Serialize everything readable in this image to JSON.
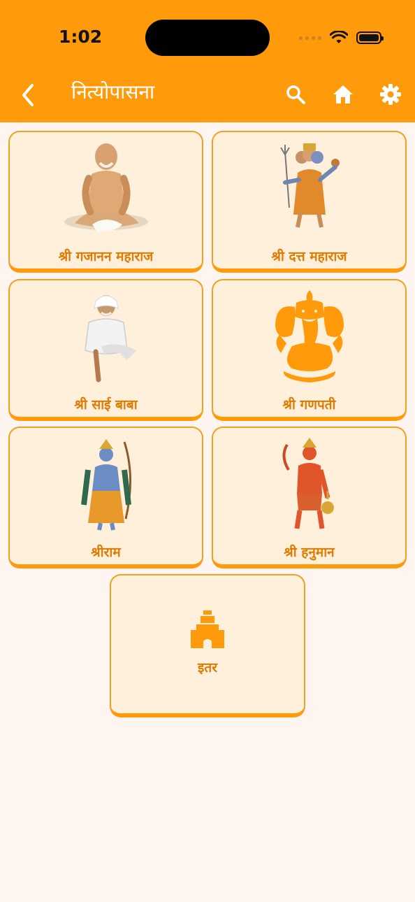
{
  "status_bar": {
    "time": "1:02"
  },
  "header": {
    "title": "नित्योपासना",
    "back_icon": "chevron-left-icon",
    "actions": [
      "search-icon",
      "home-icon",
      "gear-icon"
    ]
  },
  "colors": {
    "accent": "#FF9A0B",
    "card_bg": "#FFF0DB",
    "label": "#E07A00",
    "page_bg": "#FEF5F0"
  },
  "cards": [
    {
      "label": "श्री गजानन महाराज",
      "image": "gajanan-maharaj-image"
    },
    {
      "label": "श्री दत्त महाराज",
      "image": "datta-maharaj-image"
    },
    {
      "label": "श्री साई बाबा",
      "image": "sai-baba-image"
    },
    {
      "label": "श्री गणपती",
      "image": "ganpati-image"
    },
    {
      "label": "श्रीराम",
      "image": "shriram-image"
    },
    {
      "label": "श्री हनुमान",
      "image": "hanuman-image"
    },
    {
      "label": "इतर",
      "image": "temple-icon"
    }
  ]
}
